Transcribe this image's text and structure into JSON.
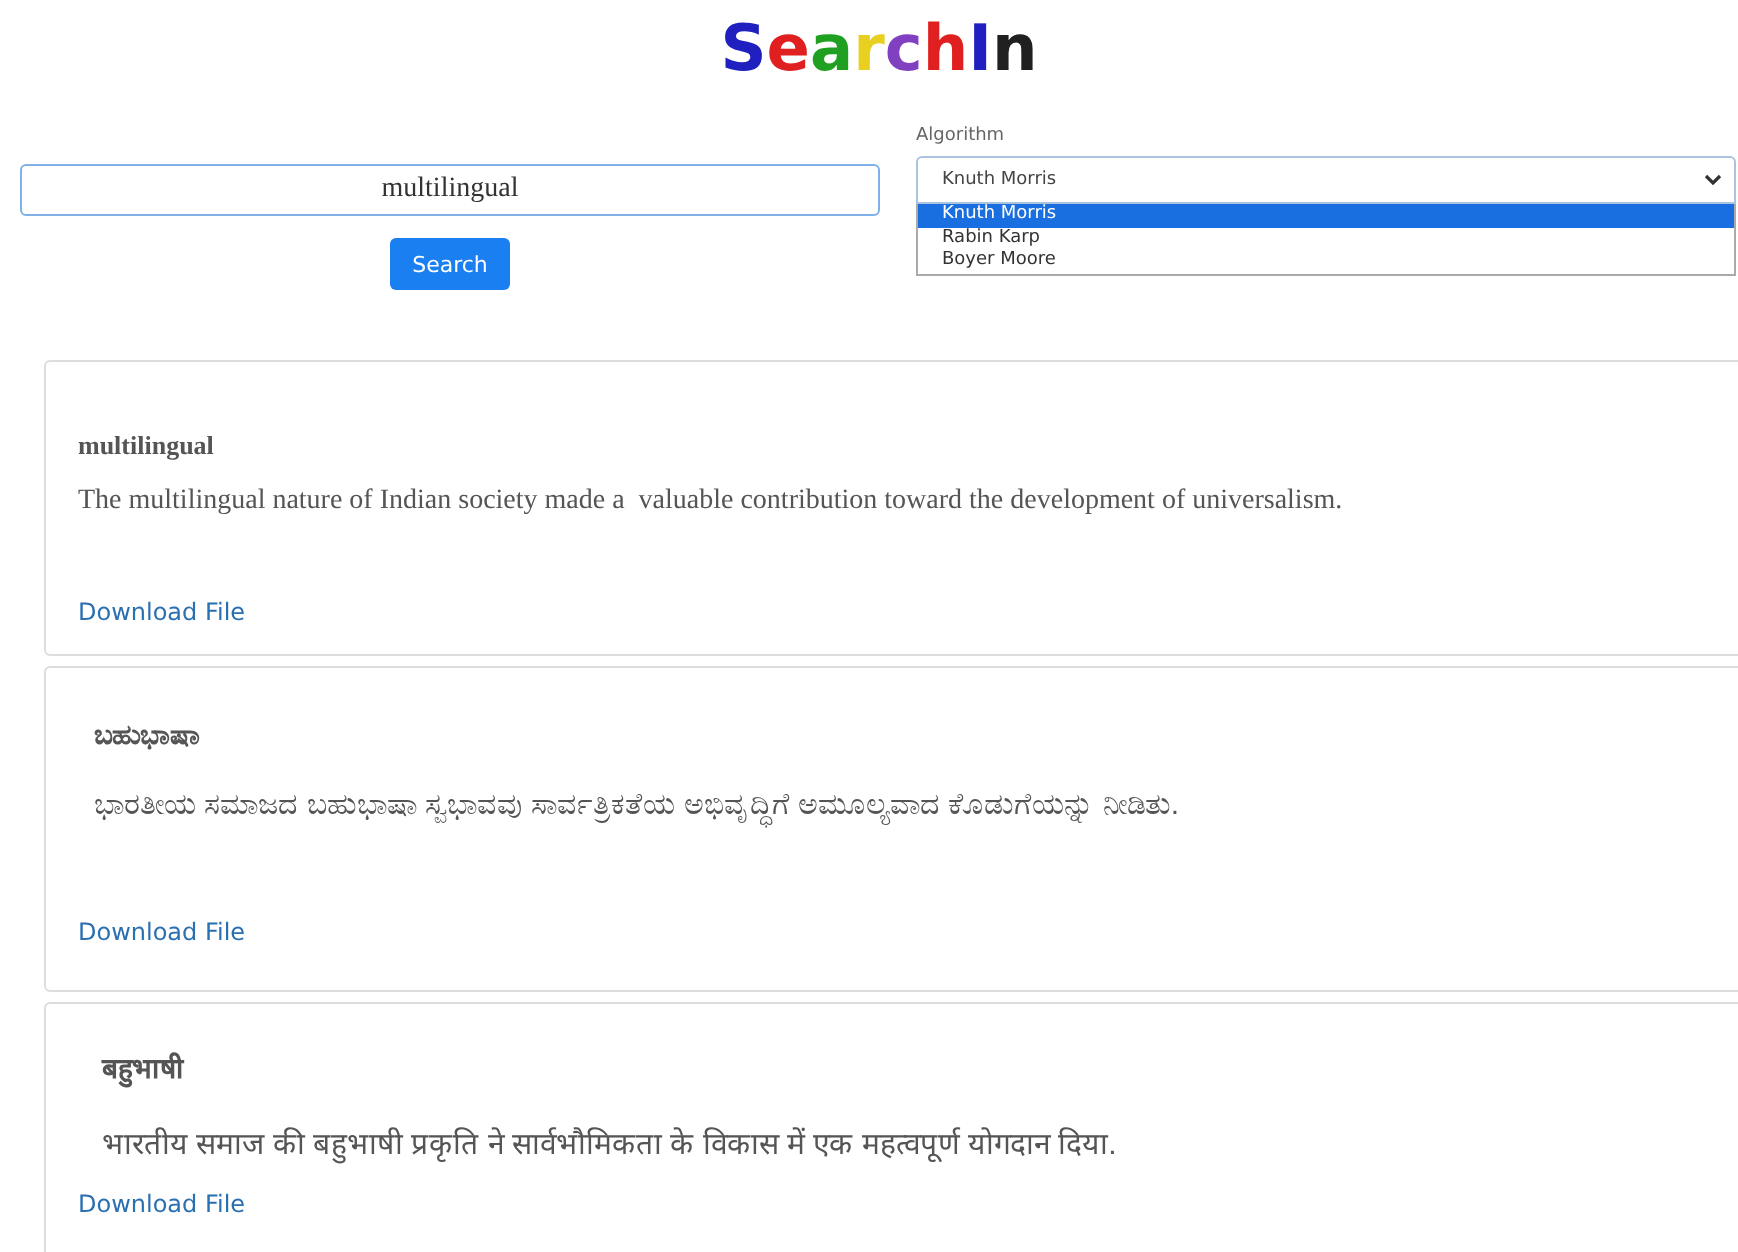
{
  "logo": [
    {
      "letter": "S",
      "color": "#2020c0"
    },
    {
      "letter": "e",
      "color": "#e02020"
    },
    {
      "letter": "a",
      "color": "#20a020"
    },
    {
      "letter": "r",
      "color": "#e8d020"
    },
    {
      "letter": "c",
      "color": "#8040c0"
    },
    {
      "letter": "h",
      "color": "#e02020"
    },
    {
      "letter": "I",
      "color": "#2020c0"
    },
    {
      "letter": "n",
      "color": "#202020"
    }
  ],
  "search": {
    "value": "multilingual",
    "button": "Search"
  },
  "algorithm": {
    "label": "Algorithm",
    "value": "Knuth Morris",
    "expanded": true,
    "options": [
      {
        "label": "Knuth Morris",
        "selected": true
      },
      {
        "label": "Rabin Karp",
        "selected": false
      },
      {
        "label": "Boyer Moore",
        "selected": false
      }
    ]
  },
  "results": [
    {
      "title": "multilingual",
      "text": "The multilingual nature of Indian society made a  valuable contribution toward the development of universalism.",
      "link": "Download File"
    },
    {
      "title": "ಬಹುಭಾಷಾ",
      "text": "ಭಾರತೀಯ ಸಮಾಜದ ಬಹುಭಾಷಾ ಸ್ವಭಾವವು ಸಾರ್ವತ್ರಿಕತೆಯ ಅಭಿವೃದ್ಧಿಗೆ ಅಮೂಲ್ಯವಾದ ಕೊಡುಗೆಯನ್ನು ನೀಡಿತು.",
      "link": "Download File"
    },
    {
      "title": "बहुभाषी",
      "text": "भारतीय समाज की बहुभाषी प्रकृति ने सार्वभौमिकता के विकास में एक महत्वपूर्ण योगदान दिया.",
      "link": "Download File"
    }
  ]
}
